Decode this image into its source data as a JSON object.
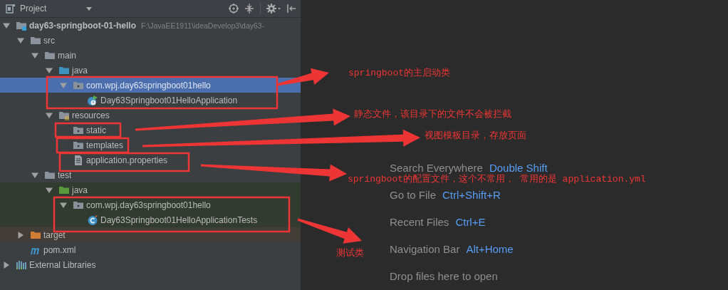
{
  "panel": {
    "title": "Project",
    "tree": [
      {
        "label": "day63-springboot-01-hello",
        "path": "F:\\JavaEE1911\\ideaDevelop3\\day63-",
        "kind": "module",
        "expanded": true,
        "selected": false,
        "children": [
          {
            "label": "src",
            "kind": "folder",
            "expanded": true,
            "selected": false,
            "children": [
              {
                "label": "main",
                "kind": "folder",
                "expanded": true,
                "selected": false,
                "children": [
                  {
                    "label": "java",
                    "kind": "source-folder",
                    "expanded": true,
                    "selected": false,
                    "children": [
                      {
                        "label": "com.wpj.day63springboot01hello",
                        "kind": "package",
                        "expanded": true,
                        "selected": true,
                        "children": [
                          {
                            "label": "Day63Springboot01HelloApplication",
                            "kind": "app-class",
                            "selected": false
                          }
                        ]
                      }
                    ]
                  },
                  {
                    "label": "resources",
                    "kind": "resources",
                    "expanded": true,
                    "selected": false,
                    "children": [
                      {
                        "label": "static",
                        "kind": "package",
                        "selected": false
                      },
                      {
                        "label": "templates",
                        "kind": "package",
                        "selected": false
                      },
                      {
                        "label": "application.properties",
                        "kind": "properties",
                        "selected": false
                      }
                    ]
                  }
                ]
              },
              {
                "label": "test",
                "kind": "folder",
                "expanded": true,
                "selected": false,
                "children": [
                  {
                    "label": "java",
                    "kind": "test-folder",
                    "expanded": true,
                    "selected": false,
                    "children": [
                      {
                        "label": "com.wpj.day63springboot01hello",
                        "kind": "package",
                        "expanded": true,
                        "selected": false,
                        "children": [
                          {
                            "label": "Day63Springboot01HelloApplicationTests",
                            "kind": "test-class",
                            "selected": false
                          }
                        ]
                      }
                    ]
                  }
                ]
              }
            ]
          },
          {
            "label": "target",
            "kind": "excluded",
            "expanded": false,
            "selected": false
          },
          {
            "label": "pom.xml",
            "kind": "maven",
            "selected": false
          }
        ]
      },
      {
        "label": "External Libraries",
        "kind": "libraries",
        "expanded": false,
        "selected": false
      }
    ]
  },
  "editor": {
    "hints": [
      {
        "label": "Search Everywhere",
        "shortcut": "Double Shift"
      },
      {
        "label": "Go to File",
        "shortcut": "Ctrl+Shift+R"
      },
      {
        "label": "Recent Files",
        "shortcut": "Ctrl+E"
      },
      {
        "label": "Navigation Bar",
        "shortcut": "Alt+Home"
      },
      {
        "label": "Drop files here to open"
      }
    ]
  },
  "annotations": [
    {
      "text": "springboot的主启动类"
    },
    {
      "text": "静态文件，该目录下的文件不会被拦截"
    },
    {
      "text": "视图模板目录，存放页面"
    },
    {
      "text": "springboot的配置文件，这个不常用， 常用的是 application.yml"
    },
    {
      "text": "测试类"
    }
  ]
}
